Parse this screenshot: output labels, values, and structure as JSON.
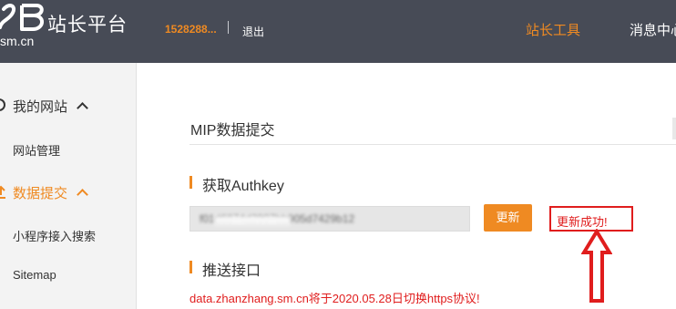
{
  "header": {
    "logo_domain": "sm.cn",
    "logo_title": "站长平台",
    "user_id": "1528288...",
    "separator": "|",
    "logout": "退出",
    "nav": {
      "tools": "站长工具",
      "messages": "消息中心"
    },
    "colors": {
      "background": "#474b56",
      "accent": "#ef8a22"
    }
  },
  "sidebar": {
    "sections": [
      {
        "label": "我的网站",
        "expanded": true,
        "active": false,
        "items": [
          "网站管理"
        ]
      },
      {
        "label": "数据提交",
        "expanded": true,
        "active": true,
        "items": [
          "小程序接入搜索",
          "Sitemap"
        ]
      }
    ]
  },
  "main": {
    "title": "MIP数据提交",
    "authkey_section": {
      "heading": "获取Authkey",
      "value_fragment": "f01d6874d2907bb905d7429b12",
      "update_button": "更新",
      "status": "更新成功!"
    },
    "push_section": {
      "heading": "推送接口",
      "notice": "data.zhanzhang.sm.cn将于2020.05.28日切换https协议!"
    }
  },
  "annotation_color": "#e01d1d"
}
